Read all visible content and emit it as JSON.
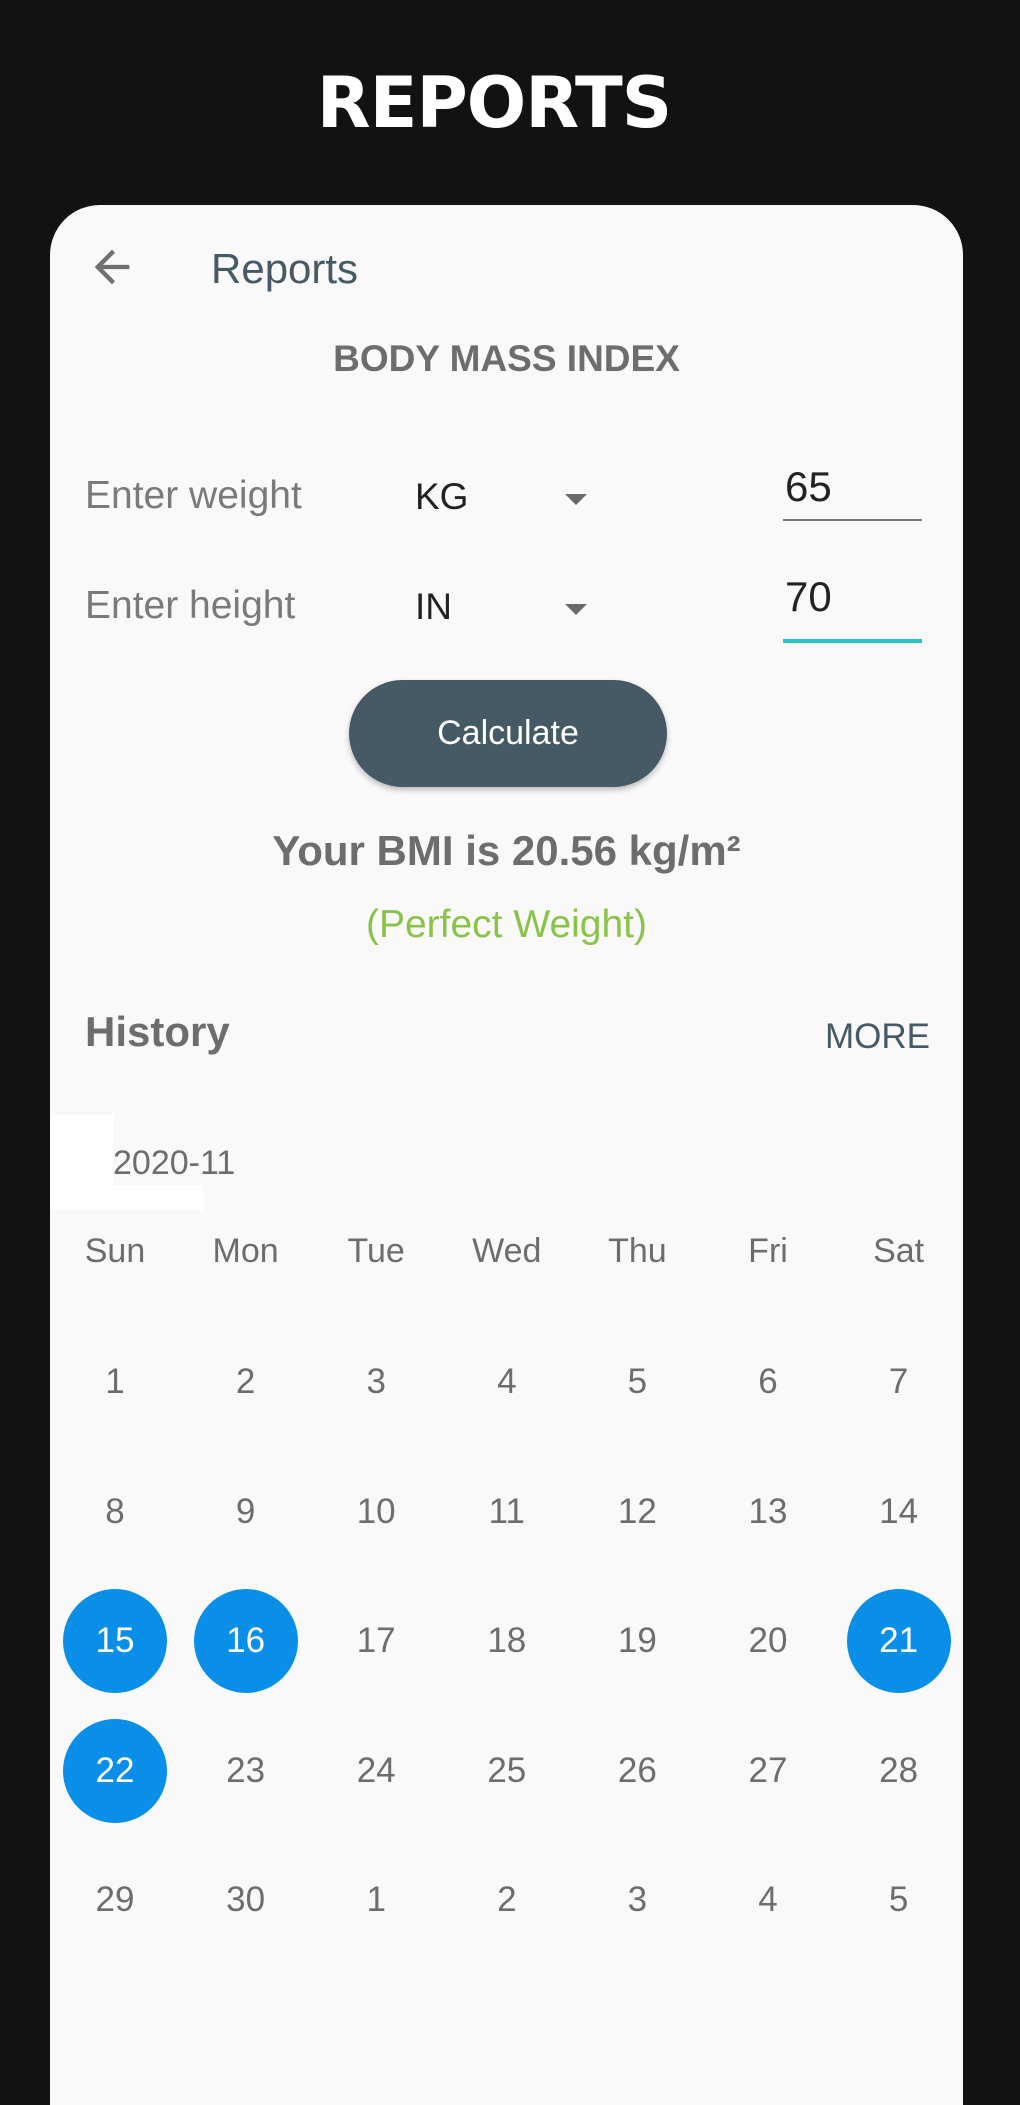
{
  "banner": {
    "title": "REPORTS"
  },
  "appbar": {
    "back_icon": "arrow-left-icon",
    "title": "Reports"
  },
  "bmi": {
    "section_title": "BODY MASS INDEX",
    "weight": {
      "label": "Enter weight",
      "unit": "KG",
      "value": "65"
    },
    "height": {
      "label": "Enter height",
      "unit": "IN",
      "value": "70"
    },
    "calculate_label": "Calculate",
    "result_text": "Your BMI is 20.56 kg/m²",
    "category_text": "(Perfect Weight)",
    "category_color": "#8bc34a",
    "focus_color": "#26c6c6",
    "button_color": "#455a64"
  },
  "history": {
    "title": "History",
    "more_label": "MORE",
    "month": "2020-11",
    "marked_color": "#0a8fe9",
    "weekdays": [
      "Sun",
      "Mon",
      "Tue",
      "Wed",
      "Thu",
      "Fri",
      "Sat"
    ],
    "weeks": [
      [
        {
          "d": "1"
        },
        {
          "d": "2"
        },
        {
          "d": "3"
        },
        {
          "d": "4"
        },
        {
          "d": "5"
        },
        {
          "d": "6"
        },
        {
          "d": "7"
        }
      ],
      [
        {
          "d": "8"
        },
        {
          "d": "9"
        },
        {
          "d": "10"
        },
        {
          "d": "11"
        },
        {
          "d": "12"
        },
        {
          "d": "13"
        },
        {
          "d": "14"
        }
      ],
      [
        {
          "d": "15",
          "marked": true
        },
        {
          "d": "16",
          "marked": true
        },
        {
          "d": "17"
        },
        {
          "d": "18"
        },
        {
          "d": "19"
        },
        {
          "d": "20"
        },
        {
          "d": "21",
          "marked": true
        }
      ],
      [
        {
          "d": "22",
          "marked": true
        },
        {
          "d": "23"
        },
        {
          "d": "24"
        },
        {
          "d": "25"
        },
        {
          "d": "26"
        },
        {
          "d": "27"
        },
        {
          "d": "28"
        }
      ],
      [
        {
          "d": "29"
        },
        {
          "d": "30"
        },
        {
          "d": "1",
          "other_month": true
        },
        {
          "d": "2",
          "other_month": true
        },
        {
          "d": "3",
          "other_month": true
        },
        {
          "d": "4",
          "other_month": true
        },
        {
          "d": "5",
          "other_month": true
        }
      ]
    ]
  }
}
